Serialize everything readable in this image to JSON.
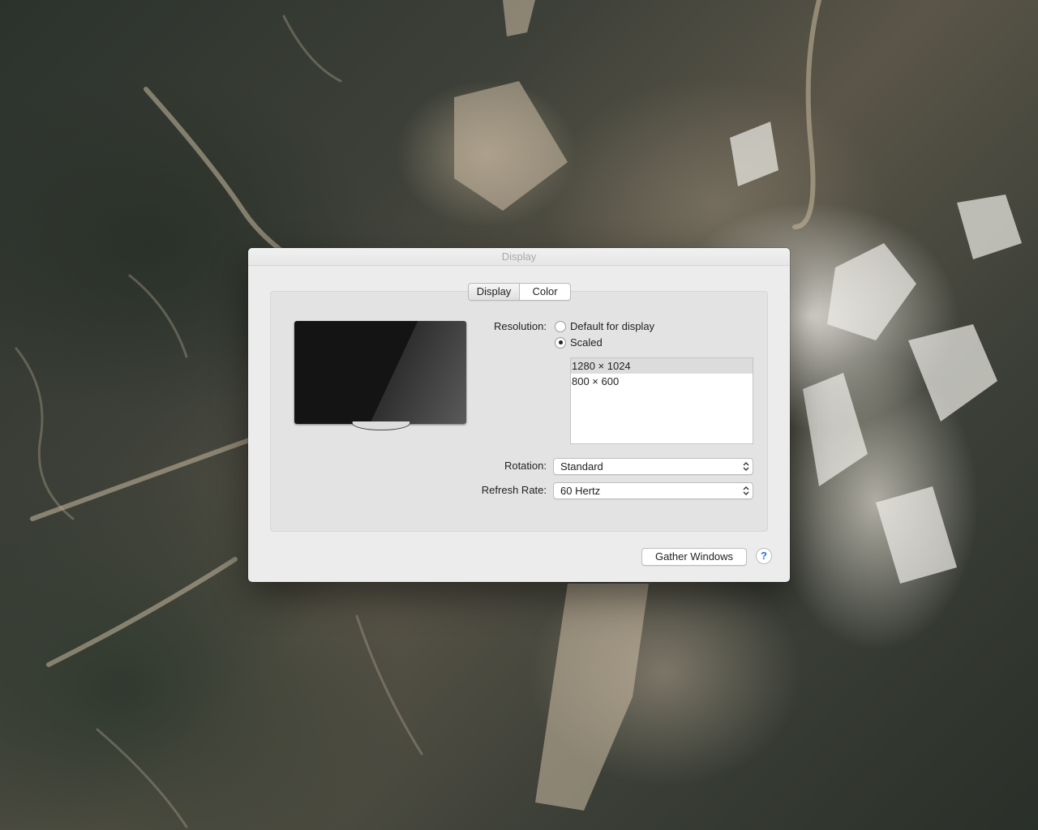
{
  "window": {
    "title": "Display"
  },
  "tabs": [
    {
      "label": "Display",
      "selected": true
    },
    {
      "label": "Color",
      "selected": false
    }
  ],
  "resolution": {
    "label": "Resolution:",
    "options": [
      {
        "label": "Default for display",
        "selected": false
      },
      {
        "label": "Scaled",
        "selected": true
      }
    ],
    "list": [
      {
        "label": "1280 × 1024",
        "selected": true
      },
      {
        "label": "800 × 600",
        "selected": false
      }
    ]
  },
  "rotation": {
    "label": "Rotation:",
    "value": "Standard"
  },
  "refresh_rate": {
    "label": "Refresh Rate:",
    "value": "60 Hertz"
  },
  "buttons": {
    "gather_windows": "Gather Windows",
    "help": "?"
  },
  "icons": {
    "monitor": "display-monitor-icon",
    "popup_arrows": "up-down-chevron-icon",
    "help": "question-mark-icon"
  },
  "colors": {
    "window_bg": "#ececec",
    "panel_bg": "#e3e3e3",
    "help_accent": "#2a6fd6",
    "list_selection": "#dcdcdc"
  }
}
